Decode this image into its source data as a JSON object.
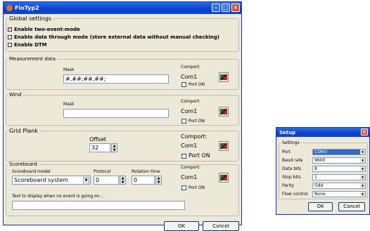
{
  "main_window": {
    "title": "FloTyp2",
    "global_settings": {
      "legend": "Global settings",
      "options": [
        {
          "label": "Enable two-event-mode",
          "checked": true
        },
        {
          "label": "Enable data through mode (store external data without manual checking)",
          "checked": false
        },
        {
          "label": "Enable DTM",
          "checked": false
        }
      ]
    },
    "measurement": {
      "legend": "Measurement data",
      "mask_label": "Mask",
      "mask_value": "#,##;##,##;",
      "comport_label": "Comport:",
      "comport_value": "Com1",
      "port_on_label": "Port ON"
    },
    "wind": {
      "legend": "Wind",
      "mask_label": "Mask",
      "mask_value": "",
      "comport_label": "Comport:",
      "comport_value": "Com1",
      "port_on_label": "Port ON"
    },
    "grid_plank": {
      "legend": "Grid Plank",
      "offset_label": "Offset",
      "offset_value": "32",
      "comport_label": "Comport:",
      "comport_value": "Com1",
      "port_on_label": "Port ON"
    },
    "scoreboard": {
      "legend": "Scoreboard",
      "model_label": "Scoreboard model",
      "model_value": "Scoreboard system",
      "protocol_label": "Protocol",
      "protocol_value": "0",
      "rotation_label": "Rotation time",
      "rotation_value": "0",
      "comport_label": "Comport:",
      "comport_value": "Com1",
      "port_on_label": "Port ON",
      "idle_text_label": "Text to display when no event is going on...",
      "idle_text_value": ""
    },
    "buttons": {
      "ok": "OK",
      "cancel": "Cancel"
    }
  },
  "setup_dialog": {
    "title": "Setup",
    "legend": "Settings",
    "rows": [
      {
        "label": "Port",
        "value": "COM3"
      },
      {
        "label": "Baud rate",
        "value": "9600"
      },
      {
        "label": "Data bits",
        "value": "8"
      },
      {
        "label": "Stop bits",
        "value": "1"
      },
      {
        "label": "Parity",
        "value": "Odd"
      },
      {
        "label": "Flow control",
        "value": "None"
      }
    ],
    "buttons": {
      "ok": "OK",
      "cancel": "Cancel"
    }
  }
}
